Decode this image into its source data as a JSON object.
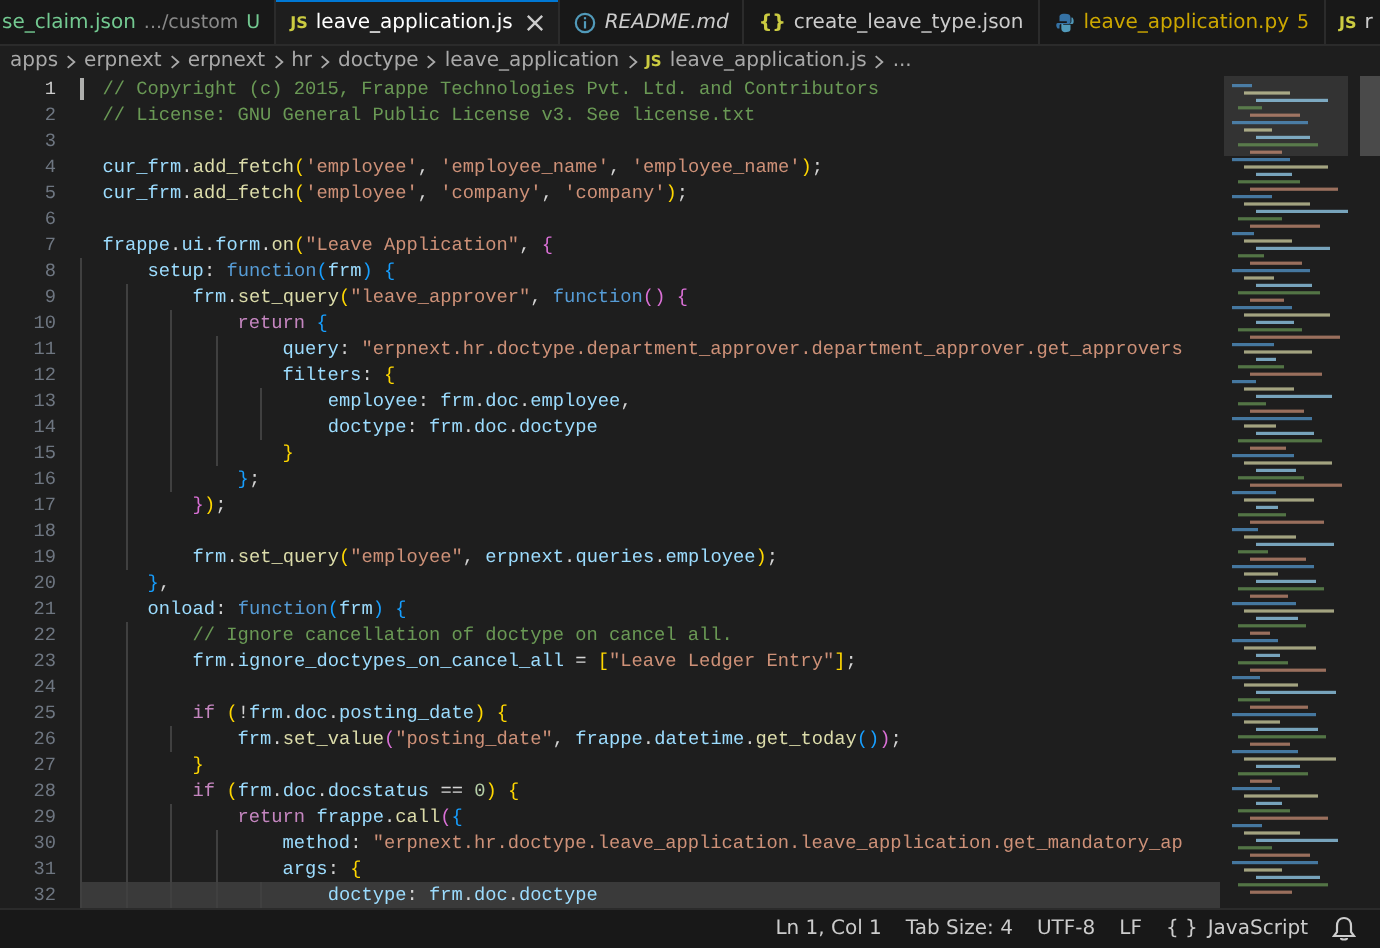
{
  "tabs": [
    {
      "label": "se_claim.json",
      "detail": ".../custom",
      "badge": "U",
      "kind": "plain",
      "color": "#73c991",
      "selected": false,
      "italic": false
    },
    {
      "label": "leave_application.js",
      "kind": "javascript",
      "icon_text": "JS",
      "color": "#ffffff",
      "selected": true,
      "italic": false
    },
    {
      "label": "README.md",
      "kind": "info",
      "color": "#cccccc",
      "selected": false,
      "italic": true
    },
    {
      "label": "create_leave_type.json",
      "kind": "json",
      "icon_text": "{}",
      "color": "#cccccc",
      "selected": false,
      "italic": false
    },
    {
      "label": "leave_application.py",
      "badge": "5",
      "kind": "python",
      "color": "#cca700",
      "selected": false,
      "italic": false
    },
    {
      "label": "r",
      "kind": "javascript",
      "icon_text": "JS",
      "color": "#cccccc",
      "selected": false,
      "italic": false
    }
  ],
  "breadcrumbs": [
    {
      "label": "apps"
    },
    {
      "label": "erpnext"
    },
    {
      "label": "erpnext"
    },
    {
      "label": "hr"
    },
    {
      "label": "doctype"
    },
    {
      "label": "leave_application"
    },
    {
      "label": "leave_application.js",
      "icon_text": "JS"
    },
    {
      "label": "..."
    }
  ],
  "editor": {
    "lines": [
      {
        "n": "1",
        "cursor": true,
        "highlighted": false,
        "text": "// Copyright (c) 2015, Frappe Technologies Pvt. Ltd. and Contributors"
      },
      {
        "n": "2",
        "cursor": false,
        "highlighted": false,
        "text": "// License: GNU General Public License v3. See license.txt"
      },
      {
        "n": "3",
        "cursor": false,
        "highlighted": false
      },
      {
        "n": "4",
        "cursor": false,
        "highlighted": false,
        "text": "cur_frm.add_fetch('employee', 'employee_name', 'employee_name');"
      },
      {
        "n": "5",
        "cursor": false,
        "highlighted": false,
        "text": "cur_frm.add_fetch('employee', 'company', 'company');"
      },
      {
        "n": "6",
        "cursor": false,
        "highlighted": false
      },
      {
        "n": "7",
        "cursor": false,
        "highlighted": false,
        "text": "frappe.ui.form.on(\"Leave Application\", {"
      },
      {
        "n": "8",
        "cursor": false,
        "highlighted": false,
        "text": "    setup: function(frm) {"
      },
      {
        "n": "9",
        "cursor": false,
        "highlighted": false,
        "text": "        frm.set_query(\"leave_approver\", function() {"
      },
      {
        "n": "10",
        "cursor": false,
        "highlighted": false,
        "text": "            return {"
      },
      {
        "n": "11",
        "cursor": false,
        "highlighted": false,
        "text": "                query: \"erpnext.hr.doctype.department_approver.department_approver.get_approvers"
      },
      {
        "n": "12",
        "cursor": false,
        "highlighted": false,
        "text": "                filters: {"
      },
      {
        "n": "13",
        "cursor": false,
        "highlighted": false,
        "text": "                    employee: frm.doc.employee,"
      },
      {
        "n": "14",
        "cursor": false,
        "highlighted": false,
        "text": "                    doctype: frm.doc.doctype"
      },
      {
        "n": "15",
        "cursor": false,
        "highlighted": false,
        "text": "                }"
      },
      {
        "n": "16",
        "cursor": false,
        "highlighted": false,
        "text": "            };"
      },
      {
        "n": "17",
        "cursor": false,
        "highlighted": false,
        "text": "        });"
      },
      {
        "n": "18",
        "cursor": false,
        "highlighted": false
      },
      {
        "n": "19",
        "cursor": false,
        "highlighted": false,
        "text": "        frm.set_query(\"employee\", erpnext.queries.employee);"
      },
      {
        "n": "20",
        "cursor": false,
        "highlighted": false,
        "text": "    },"
      },
      {
        "n": "21",
        "cursor": false,
        "highlighted": false,
        "text": "    onload: function(frm) {"
      },
      {
        "n": "22",
        "cursor": false,
        "highlighted": false,
        "text": "        // Ignore cancellation of doctype on cancel all."
      },
      {
        "n": "23",
        "cursor": false,
        "highlighted": false,
        "text": "        frm.ignore_doctypes_on_cancel_all = [\"Leave Ledger Entry\"];"
      },
      {
        "n": "24",
        "cursor": false,
        "highlighted": false
      },
      {
        "n": "25",
        "cursor": false,
        "highlighted": false,
        "text": "        if (!frm.doc.posting_date) {"
      },
      {
        "n": "26",
        "cursor": false,
        "highlighted": false,
        "text": "            frm.set_value(\"posting_date\", frappe.datetime.get_today());"
      },
      {
        "n": "27",
        "cursor": false,
        "highlighted": false,
        "text": "        }"
      },
      {
        "n": "28",
        "cursor": false,
        "highlighted": false,
        "text": "        if (frm.doc.docstatus == 0) {"
      },
      {
        "n": "29",
        "cursor": false,
        "highlighted": false,
        "text": "            return frappe.call({"
      },
      {
        "n": "30",
        "cursor": false,
        "highlighted": false,
        "text": "                method: \"erpnext.hr.doctype.leave_application.leave_application.get_mandatory_ap"
      },
      {
        "n": "31",
        "cursor": false,
        "highlighted": false,
        "text": "                args: {"
      },
      {
        "n": "32",
        "cursor": false,
        "highlighted": true,
        "text": "                    doctype: frm.doc.doctype"
      }
    ]
  },
  "status_bar": {
    "position": "Ln 1, Col 1",
    "tab_size": "Tab Size: 4",
    "encoding": "UTF-8",
    "eol": "LF",
    "language_icon": "{ }",
    "language": "JavaScript"
  }
}
